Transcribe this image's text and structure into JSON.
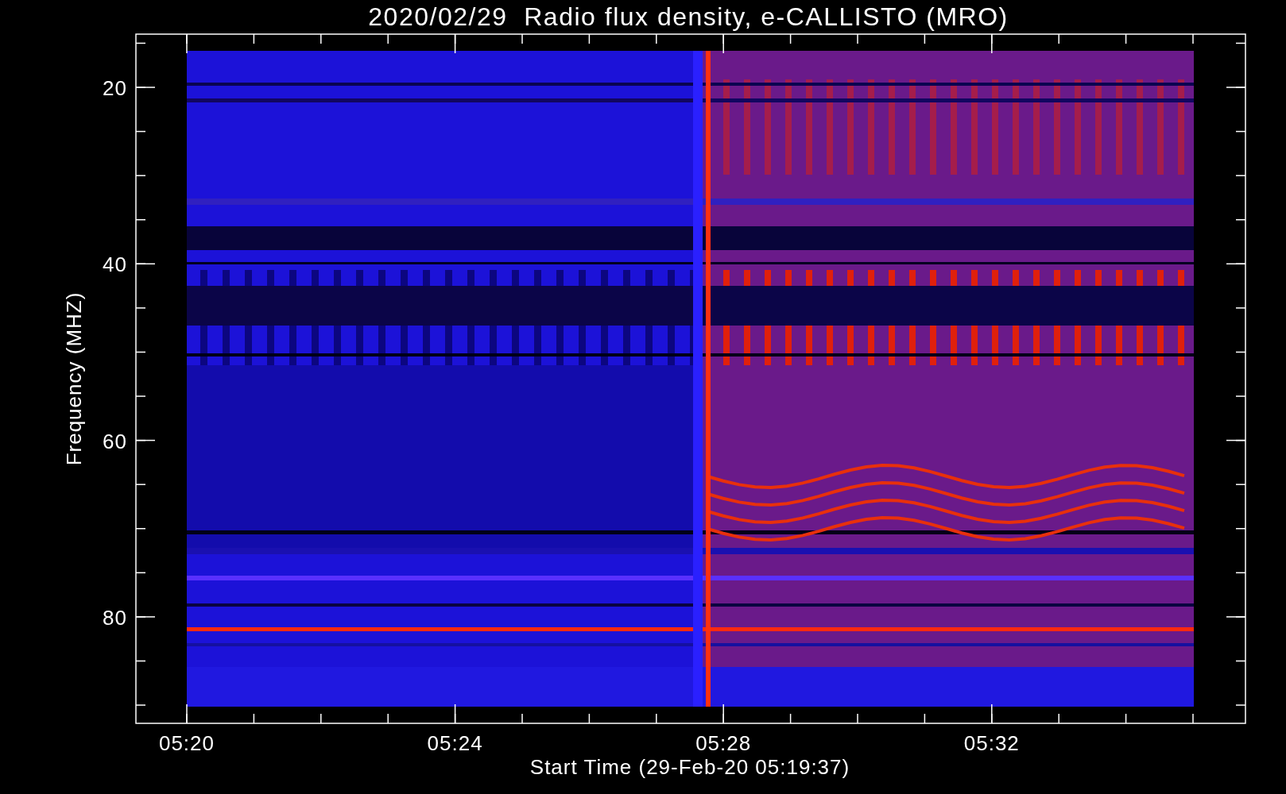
{
  "title": "2020/02/29  Radio flux density, e-CALLISTO (MRO)",
  "y_axis": {
    "label": "Frequency (MHZ)",
    "ticks": [
      "20",
      "40",
      "60",
      "80"
    ]
  },
  "x_axis": {
    "label": "Start Time (29-Feb-20 05:19:37)",
    "ticks": [
      "05:20",
      "05:24",
      "05:28",
      "05:32"
    ]
  }
}
